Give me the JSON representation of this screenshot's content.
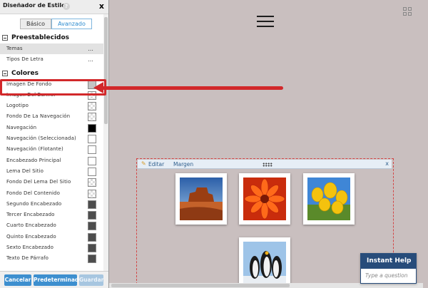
{
  "panel": {
    "title": "Diseñador de Estilo",
    "help_label": "?",
    "close_label": "x",
    "tabs": [
      {
        "label": "Básico",
        "active": false
      },
      {
        "label": "Avanzado",
        "active": true
      }
    ],
    "sections": {
      "presets_label": "Preestablecidos",
      "presets": [
        {
          "label": "Temas",
          "more": "..."
        },
        {
          "label": "Tipos De Letra",
          "more": "..."
        }
      ],
      "colors_label": "Colores",
      "colors": [
        {
          "label": "Imagen De Fondo",
          "swatch": "grayish"
        },
        {
          "label": "Imagen Del Banner",
          "swatch": "checker"
        },
        {
          "label": "Logotipo",
          "swatch": "checker"
        },
        {
          "label": "Fondo De La Navegación",
          "swatch": "checker"
        },
        {
          "label": "Navegación",
          "swatch": "black"
        },
        {
          "label": "Navegación (Seleccionada)",
          "swatch": "white"
        },
        {
          "label": "Navegación (Flotante)",
          "swatch": "white"
        },
        {
          "label": "Encabezado Principal",
          "swatch": "white"
        },
        {
          "label": "Lema Del Sitio",
          "swatch": "white"
        },
        {
          "label": "Fondo Del Lema Del Sitio",
          "swatch": "checker"
        },
        {
          "label": "Fondo Del Contenido",
          "swatch": "checker"
        },
        {
          "label": "Segundo Encabezado",
          "swatch": "dark"
        },
        {
          "label": "Tercer Encabezado",
          "swatch": "dark"
        },
        {
          "label": "Cuarto Encabezado",
          "swatch": "dark"
        },
        {
          "label": "Quinto Encabezado",
          "swatch": "dark"
        },
        {
          "label": "Sexto Encabezado",
          "swatch": "dark"
        },
        {
          "label": "Texto De Párrafo",
          "swatch": "dark"
        }
      ]
    },
    "footer": {
      "cancel_label": "Cancelar",
      "default_label": "Predeterminado",
      "save_label": "Guardar"
    }
  },
  "widget": {
    "edit_label": "Editar",
    "margin_label": "Margen",
    "close_label": "x",
    "photos": [
      "desert-butte",
      "orange-flower",
      "yellow-tulips",
      "penguins"
    ]
  },
  "instant_help": {
    "title": "Instant Help",
    "placeholder": "Type a question"
  },
  "colors": {
    "accent": "#3d8fcf",
    "highlight": "#d2282a",
    "canvas": "#c9bfbf",
    "help_header": "#274c7a"
  }
}
